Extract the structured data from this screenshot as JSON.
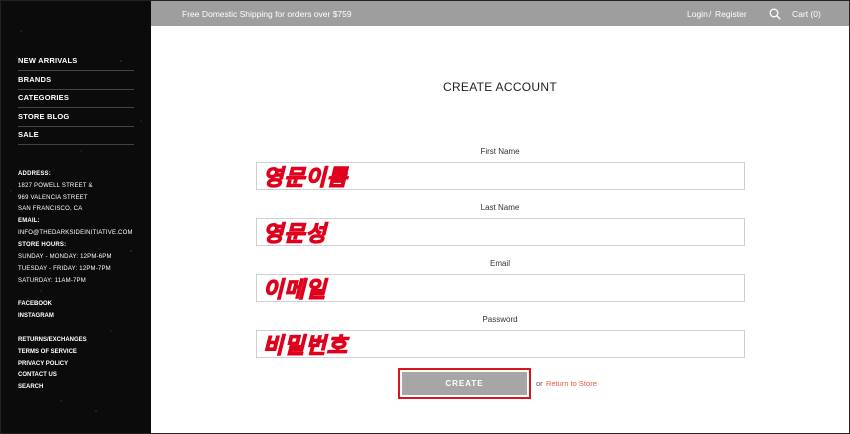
{
  "topbar": {
    "promo": "Free Domestic Shipping for orders over $759",
    "login": "Login",
    "separator": "/",
    "register": "Register",
    "cart": "Cart (0)"
  },
  "sidebar": {
    "nav": [
      "NEW ARRIVALS",
      "BRANDS",
      "CATEGORIES",
      "STORE BLOG",
      "SALE"
    ],
    "info": {
      "address_label": "ADDRESS:",
      "address_1": "1827 POWELL STREET &",
      "address_2": "969 VALENCIA STREET",
      "address_3": "SAN FRANCISCO, CA",
      "email_label": "EMAIL:",
      "email": "INFO@THEDARKSIDEINITIATIVE.COM",
      "hours_label": "STORE HOURS:",
      "hours_1": "SUNDAY - MONDAY: 12PM-6PM",
      "hours_2": "TUESDAY - FRIDAY: 12PM-7PM",
      "hours_3": "SATURDAY: 11AM-7PM"
    },
    "social": [
      "FACEBOOK",
      "INSTAGRAM"
    ],
    "footer_links": [
      "RETURNS/EXCHANGES",
      "TERMS OF SERVICE",
      "PRIVACY POLICY",
      "CONTACT US",
      "SEARCH"
    ]
  },
  "form": {
    "title": "CREATE ACCOUNT",
    "first_name_label": "First Name",
    "first_name_value": "영문이름",
    "last_name_label": "Last Name",
    "last_name_value": "영문성",
    "email_label": "Email",
    "email_value": "이메일",
    "password_label": "Password",
    "password_value": "비밀번호",
    "create_label": "CREATE",
    "or_text": "or",
    "return_link": "Return to Store"
  },
  "colors": {
    "topbar_bg": "#9e9e9e",
    "sidebar_bg": "#0b0b0b",
    "button_bg": "#a6a6a6",
    "highlight_red": "#d9141c",
    "link_color": "#e8573d"
  }
}
